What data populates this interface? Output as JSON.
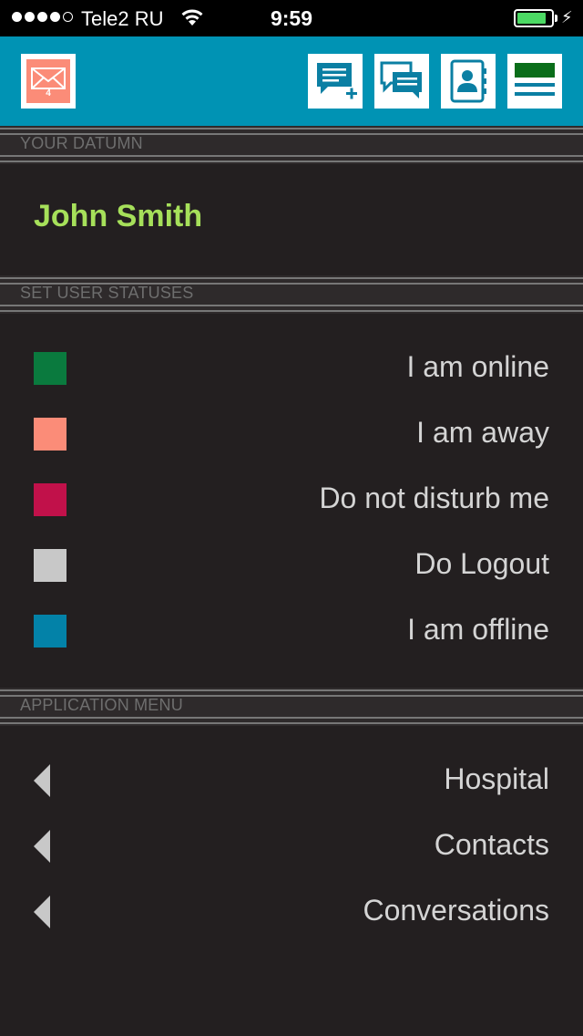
{
  "status_bar": {
    "carrier": "Tele2 RU",
    "time": "9:59",
    "signal_bars_filled": 4,
    "signal_bars_total": 5,
    "battery_level": 0.85
  },
  "header": {
    "mail_badge": "4",
    "icons": [
      "mail-icon",
      "new-message-icon",
      "chat-bubbles-icon",
      "address-book-icon",
      "menu-icon"
    ],
    "colors": {
      "bar": "#0093b4",
      "accent": "#a6e05a"
    }
  },
  "sections": {
    "datum": {
      "title": "YOUR DATUMN"
    },
    "statuses": {
      "title": "SET USER STATUSES"
    },
    "app_menu": {
      "title": "APPLICATION MENU"
    }
  },
  "user": {
    "name": "John Smith"
  },
  "statuses": [
    {
      "label": "I am online",
      "color": "#0a7a3e"
    },
    {
      "label": "I am away",
      "color": "#fb8c78"
    },
    {
      "label": "Do not disturb me",
      "color": "#c1114a"
    },
    {
      "label": "Do Logout",
      "color": "#c8c8c8"
    },
    {
      "label": "I am offline",
      "color": "#0382a8"
    }
  ],
  "menu": [
    {
      "label": "Hospital"
    },
    {
      "label": "Contacts"
    },
    {
      "label": "Conversations"
    }
  ]
}
